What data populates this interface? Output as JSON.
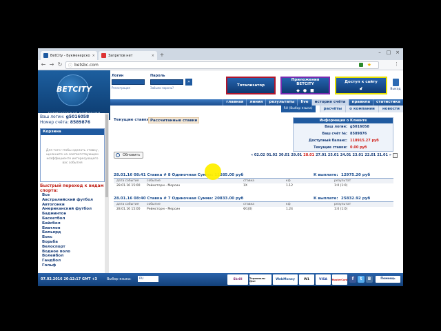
{
  "browser": {
    "tabs": [
      {
        "label": "BetCity - Букмекерско"
      },
      {
        "label": "Запретов нет"
      }
    ],
    "url": "betsbc.com"
  },
  "header": {
    "brand": "BETCITY",
    "tagline": "БУКМЕКЕРСКАЯ КОМПАНИЯ",
    "login_label": "Логин",
    "password_label": "Пароль",
    "register_link": "Регистрация",
    "forgot_link": "Забыли пароль?",
    "promo_totalizator": "Тотализатор",
    "promo_apps": "Приложения BETCITY",
    "promo_access": "Доступ к сайту",
    "exit_label": "Выход"
  },
  "nav": {
    "main": [
      "главная",
      "линия",
      "результаты",
      "live",
      "история счёта",
      "правила",
      "статистика"
    ],
    "lang_button": "RU (Выбор языка)",
    "sub": [
      "расчёты",
      "о компании",
      "новости"
    ]
  },
  "sidebar": {
    "login_label": "Ваш логин:",
    "login_value": "g5016058",
    "account_label": "Номер счёта:",
    "account_value": "8589876",
    "coupon_title": "Корзина",
    "coupon_text": "Для того чтобы сделать ставку, щелкните на соответствующем коэффициенте интересующего вас события",
    "quick_title": "Быстрый переход к видам спорта:",
    "sports": [
      "Все",
      "Австралийский футбол",
      "Автогонки",
      "Американский футбол",
      "Бадминтон",
      "Баскетбол",
      "Бейсбол",
      "Биатлон",
      "Бильярд",
      "Бокс",
      "Борьба",
      "Велоспорт",
      "Водное поло",
      "Волейбол",
      "Гандбол",
      "Гольф"
    ]
  },
  "content": {
    "tab_current": "Текущие ставки",
    "tab_settled": "Рассчитанные ставки",
    "info": {
      "title": "Информация о Клиенте",
      "rows": [
        {
          "k": "Ваш логин:",
          "v": "g5016058"
        },
        {
          "k": "Ваш счёт №:",
          "v": "8589876"
        },
        {
          "k": "Доступный баланс:",
          "v": "118915.27 руб"
        },
        {
          "k": "Текущие ставки:",
          "v": "0.00 руб"
        }
      ]
    },
    "refresh": "Обновить",
    "dates": [
      "« 02.02",
      "01.02",
      "30.01",
      "29.01",
      "28.01",
      "27.01",
      "25.01",
      "24.01",
      "23.01",
      "22.01",
      "21.01 »"
    ],
    "bets": [
      {
        "head": "28.01.16 08:41  Ставка # 8  Одиночная  Сумма: 11585.00 руб",
        "payout_label": "К выплате:",
        "payout": "12975.20 руб",
        "cols": [
          "дата события",
          "событие",
          "ставка",
          "кф",
          "результат"
        ],
        "row": [
          "28.01.16 15:00",
          "Реймсторм - Мерсин",
          "1X",
          "1.12",
          "1:0 (1:0)"
        ]
      },
      {
        "head": "28.01.16 08:40  Ставка # 7  Одиночная  Сумма: 20833.00 руб",
        "payout_label": "К выплате:",
        "payout": "25832.92 руб",
        "cols": [
          "дата события",
          "событие",
          "ставка",
          "кф",
          "результат"
        ],
        "row": [
          "28.01.16 15:00",
          "Реймсторм - Мерсин",
          "Ф1(0)",
          "1.24",
          "1:0 (1:0)"
        ]
      }
    ]
  },
  "footer": {
    "datetime": "07.02.2016  20:12:17  GMT +3",
    "lang_label": "Выбор языка:",
    "lang_value": "RU",
    "payments": [
      "Skrill",
      "Терминалы Qiwi",
      "WebMoney",
      "W1",
      "VISA",
      "MasterCard"
    ],
    "help": "Помощь"
  },
  "colors": {
    "brand_blue": "#1f5aa0",
    "highlight_red": "#d0201a",
    "totalizator_border": "#b0152c",
    "apps_border": "#7a2bb0",
    "access_border": "#e6e000"
  }
}
